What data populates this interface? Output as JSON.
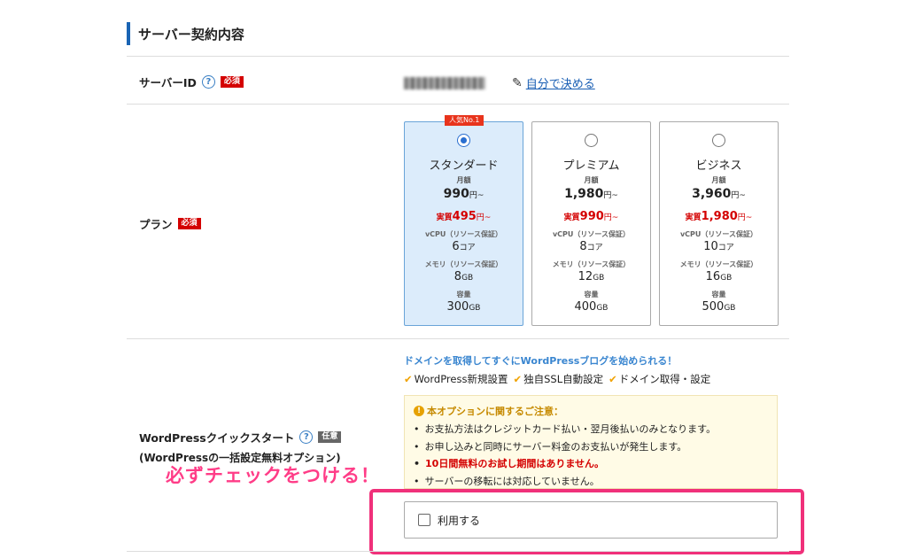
{
  "section": {
    "title": "サーバー契約内容"
  },
  "server_id": {
    "label": "サーバーID",
    "required_badge": "必須",
    "value_blurred": "",
    "edit_link": "自分で決める",
    "help_icon": "?"
  },
  "plan": {
    "label": "プラン",
    "required_badge": "必須",
    "popular_badge": "人気No.1",
    "monthly_label": "月額",
    "actual_prefix": "実質",
    "yen_suffix": "円~",
    "vcpu_label": "vCPU（リソース保証）",
    "memory_label": "メモリ（リソース保証）",
    "storage_label": "容量",
    "core_unit": "コア",
    "gb_unit": "GB",
    "options": [
      {
        "name": "スタンダード",
        "price": "990",
        "actual": "495",
        "vcpu": "6",
        "memory": "8",
        "storage": "300",
        "selected": true
      },
      {
        "name": "プレミアム",
        "price": "1,980",
        "actual": "990",
        "vcpu": "8",
        "memory": "12",
        "storage": "400",
        "selected": false
      },
      {
        "name": "ビジネス",
        "price": "3,960",
        "actual": "1,980",
        "vcpu": "10",
        "memory": "16",
        "storage": "500",
        "selected": false
      }
    ]
  },
  "wordpress": {
    "label": "WordPressクイックスタート",
    "optional_badge": "任意",
    "sublabel": "(WordPressの一括設定無料オプション)",
    "lead": "ドメインを取得してすぐにWordPressブログを始められる！",
    "features": [
      "WordPress新規設置",
      "独自SSL自動設定",
      "ドメイン取得・設定"
    ],
    "notice_title": "本オプションに関するご注意：",
    "notice_items": [
      "お支払方法はクレジットカード払い・翌月後払いのみとなります。",
      "お申し込みと同時にサーバー料金のお支払いが発生します。",
      "10日間無料のお試し期間はありません。",
      "サーバーの移転には対応していません。"
    ],
    "checkbox_label": "利用する",
    "checked": false
  },
  "annotation": {
    "text": "必ずチェックをつける！"
  },
  "colors": {
    "accent": "#1a64b4",
    "required": "#d40000",
    "highlight": "#f0307a",
    "annotation": "#ff3c87"
  }
}
